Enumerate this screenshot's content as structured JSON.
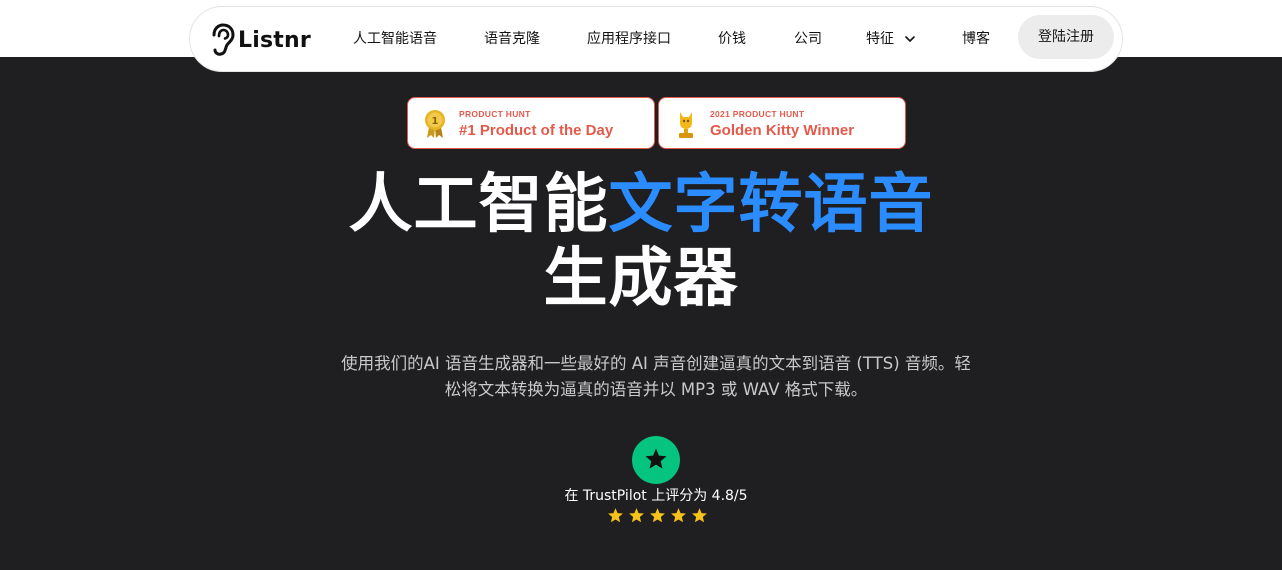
{
  "nav": {
    "logo_text": "Listnr",
    "items": [
      "人工智能语音",
      "语音克隆",
      "应用程序接口",
      "价钱",
      "公司",
      "特征",
      "博客"
    ],
    "login_label": "登陆注册"
  },
  "badges": [
    {
      "small": "PRODUCT HUNT",
      "big": "#1 Product of the Day",
      "icon": "medal-icon"
    },
    {
      "small": "2021 PRODUCT HUNT",
      "big": "Golden Kitty Winner",
      "icon": "trophy-icon"
    }
  ],
  "hero": {
    "headline_white": "人工智能",
    "headline_accent": "文字转语音",
    "headline_line2": "生成器",
    "subtext": "使用我们的AI 语音生成器和一些最好的 AI 声音创建逼真的文本到语音 (TTS) 音频。轻松将文本转换为逼真的语音并以 MP3 或 WAV 格式下载。"
  },
  "rating": {
    "text": "在 TrustPilot 上评分为 4.8/5",
    "stars": 5
  },
  "colors": {
    "background": "#1f1e21",
    "accent": "#2b8cff",
    "badge": "#e35a4b",
    "trustpilot": "#04c47f",
    "star": "#f7c21b"
  }
}
